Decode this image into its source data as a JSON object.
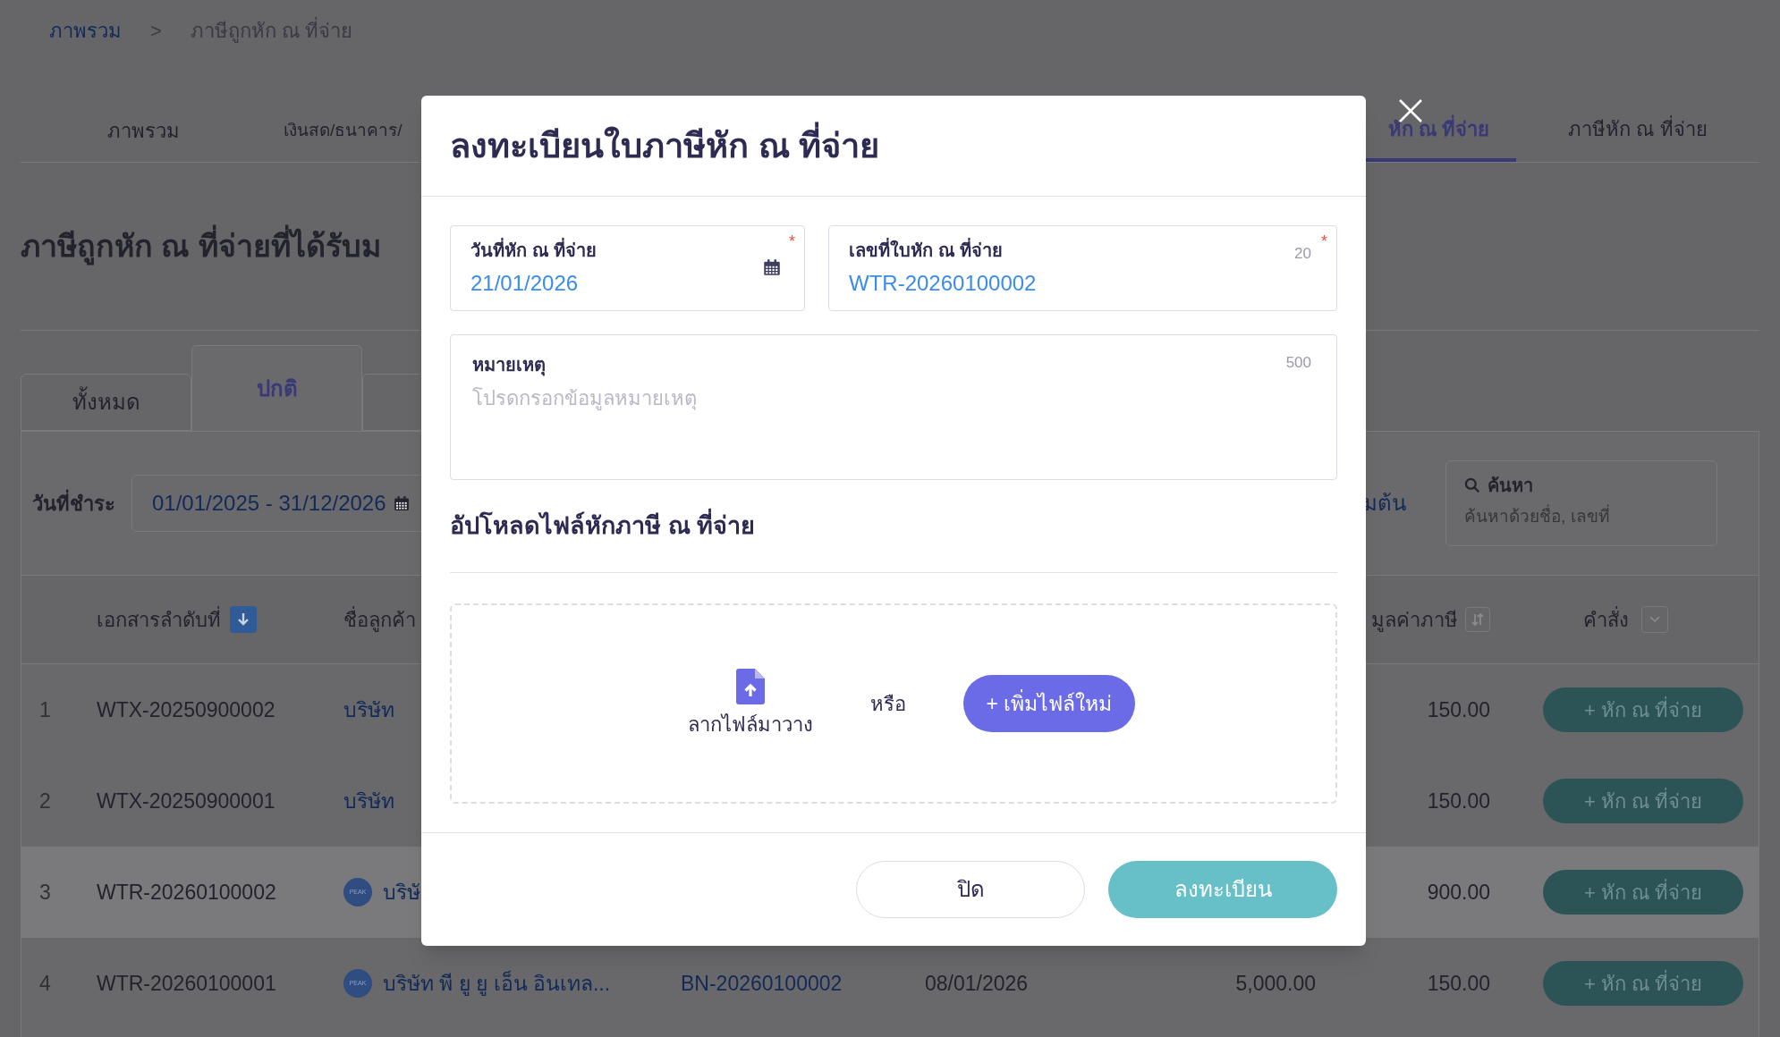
{
  "breadcrumb": [
    {
      "label": "ภาพรวม",
      "kind": "link"
    },
    {
      "label": ">",
      "kind": "separator"
    },
    {
      "label": "ภาษีถูกหัก ณ ที่จ่าย",
      "kind": "current"
    }
  ],
  "nav_tabs": [
    {
      "label": "ภาพรวม",
      "selected": false
    },
    {
      "label": "เงินสด/ธนาคาร/",
      "selected": false
    },
    {
      "label": "หัก ณ ที่จ่าย",
      "selected": true
    },
    {
      "label": "ภาษีหัก ณ ที่จ่าย",
      "selected": false
    }
  ],
  "page_title": "ภาษีถูกหัก ณ ที่จ่ายที่ได้รับม",
  "filter_tabs": [
    {
      "label": "ทั้งหมด",
      "selected": false
    },
    {
      "label": "ปกติ",
      "selected": true
    },
    {
      "selected": false
    }
  ],
  "filters": {
    "date_label": "วันที่ชำระ",
    "date_range": "01/01/2025 - 31/12/2026",
    "reset_link": "มต้น",
    "search": {
      "label": "ค้นหา",
      "placeholder": "ค้นหาด้วยชื่อ, เลขที่"
    }
  },
  "table": {
    "columns": [
      {
        "label": "เอกสารลำดับที่",
        "sort_active": true
      },
      {
        "label": "ชื่อลูกค้า"
      },
      {
        "label": "มูลค่าภาษี",
        "sort_active": false
      },
      {
        "label": "คำสั่ง",
        "menu": true
      }
    ],
    "rows": [
      {
        "index": "1",
        "doc_no": "WTX-20250900002",
        "customer": "บริษัท",
        "tax": "150.00",
        "action": "+ หัก ณ ที่จ่าย",
        "highlighted": false
      },
      {
        "index": "2",
        "doc_no": "WTX-20250900001",
        "customer": "บริษัท",
        "tax": "150.00",
        "action": "+ หัก ณ ที่จ่าย",
        "highlighted": false
      },
      {
        "index": "3",
        "doc_no": "WTR-20260100002",
        "avatar": "PEAK",
        "customer": "บริษั",
        "tax": "900.00",
        "action": "+ หัก ณ ที่จ่าย",
        "highlighted": true
      },
      {
        "index": "4",
        "doc_no": "WTR-20260100001",
        "avatar": "PEAK",
        "customer": "บริษัท พี ยู ยู เอ็น อินเทล...",
        "reference": "BN-20260100002",
        "date": "08/01/2026",
        "amount": "5,000.00",
        "tax": "150.00",
        "action": "+ หัก ณ ที่จ่าย",
        "highlighted": false
      }
    ]
  },
  "dialog": {
    "title": "ลงทะเบียนใบภาษีหัก ณ ที่จ่าย",
    "date_field": {
      "label": "วันที่หัก ณ ที่จ่าย",
      "value": "21/01/2026",
      "required_mark": "*"
    },
    "number_field": {
      "label": "เลขที่ใบหัก ณ ที่จ่าย",
      "value": "WTR-20260100002",
      "counter": "20",
      "required_mark": "*"
    },
    "remark_field": {
      "label": "หมายเหตุ",
      "placeholder": "โปรดกรอกข้อมูลหมายเหตุ",
      "counter": "500"
    },
    "upload_title": "อัปโหลดไฟล์หักภาษี ณ ที่จ่าย",
    "dropzone": {
      "drop_text": "ลากไฟล์มาวาง",
      "or_text": "หรือ",
      "add_button": "+ เพิ่มไฟล์ใหม่"
    },
    "buttons": [
      {
        "label": "ปิด",
        "kind": "secondary"
      },
      {
        "label": "ลงทะเบียน",
        "kind": "primary"
      }
    ]
  }
}
